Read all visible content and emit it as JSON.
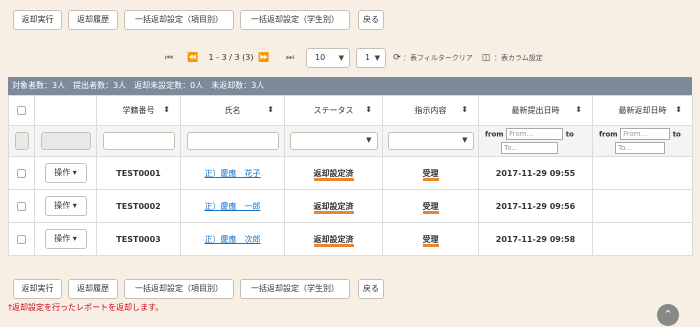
{
  "top_buttons": {
    "return_exec": "返却実行",
    "return_history": "返却履歴",
    "bulk_by_item": "一括返却設定（項目別）",
    "bulk_by_student": "一括返却設定（学生別）",
    "back": "戻る"
  },
  "pager": {
    "first": "⏮",
    "prev": "⏪",
    "range": "1 - 3 / 3 (3)",
    "next": "⏩",
    "last": "⏭",
    "page_size": "10",
    "page": "1",
    "clear_filter": "：表フィルタークリア",
    "column_settings": "：表カラム設定"
  },
  "status_bar": "対象者数：3人　提出者数：3人　返却未設定数：0人　未返却数：3人",
  "columns": [
    "学籍番号",
    "氏名",
    "ステータス",
    "指示内容",
    "最新提出日時",
    "最新返却日時"
  ],
  "filter": {
    "from": "from",
    "to": "to",
    "from_placeholder": "From...",
    "to_placeholder": "To..."
  },
  "rows": [
    {
      "op": "操作",
      "id": "TEST0001",
      "name": "正）慶應　花子",
      "status": "返却設定済",
      "instruction": "受理",
      "submitted": "2017-11-29 09:55",
      "returned": ""
    },
    {
      "op": "操作",
      "id": "TEST0002",
      "name": "正）慶應　一郎",
      "status": "返却設定済",
      "instruction": "受理",
      "submitted": "2017-11-29 09:56",
      "returned": ""
    },
    {
      "op": "操作",
      "id": "TEST0003",
      "name": "正）慶應　次郎",
      "status": "返却設定済",
      "instruction": "受理",
      "submitted": "2017-11-29 09:58",
      "returned": ""
    }
  ],
  "bottom_buttons": {
    "return_exec": "返却実行",
    "return_history": "返却履歴",
    "bulk_by_item": "一括返却設定（項目別）",
    "bulk_by_student": "一括返却設定（学生別）",
    "back": "戻る"
  },
  "note": "†返却設定を行ったレポートを返却します。",
  "colors": {
    "background": "#f8efe4",
    "status_bar": "#7c8a9b",
    "underline": "#e98632",
    "link": "#1a73c8",
    "note": "#d0021b"
  }
}
